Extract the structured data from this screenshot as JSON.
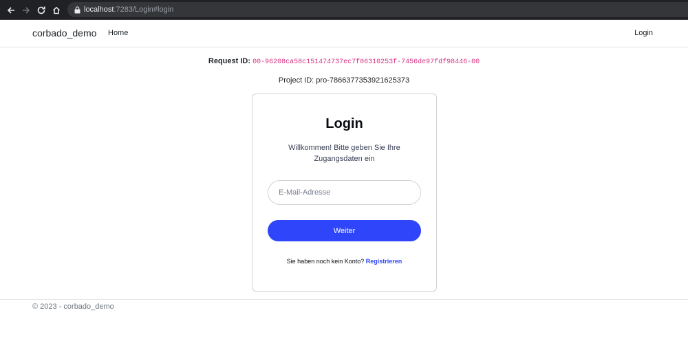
{
  "browser": {
    "url_host": "localhost",
    "url_rest": ":7283/Login#login"
  },
  "navbar": {
    "brand": "corbado_demo",
    "home_label": "Home",
    "login_label": "Login"
  },
  "info": {
    "request_label": "Request ID:",
    "request_id": "00-96208ca58c151474737ec7f06310253f-7456de97fdf98446-00",
    "project_text": "Project ID: pro-7866377353921625373"
  },
  "login_card": {
    "title": "Login",
    "subtitle": "Willkommen! Bitte geben Sie Ihre Zugangsdaten ein",
    "email_placeholder": "E-Mail-Adresse",
    "email_value": "",
    "continue_label": "Weiter",
    "no_account_text": "Sie haben noch kein Konto?",
    "register_label": "Registrieren"
  },
  "footer": {
    "text": "© 2023 - corbado_demo"
  },
  "colors": {
    "accent": "#2e45fa",
    "request_id": "#d63384"
  }
}
